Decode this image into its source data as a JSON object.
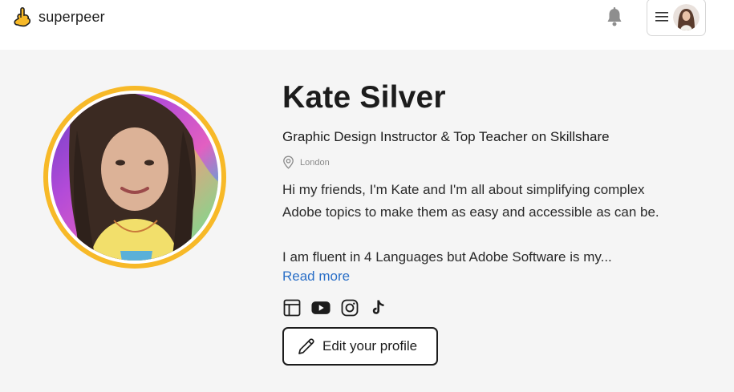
{
  "brand": {
    "name": "superpeer",
    "accent": "#f7b928"
  },
  "header": {
    "icons": {
      "notifications": "bell-icon",
      "menu": "hamburger-icon"
    }
  },
  "profile": {
    "name": "Kate Silver",
    "headline": "Graphic Design Instructor & Top Teacher on Skillshare",
    "location": "London",
    "bio_line1": "Hi my friends, I'm Kate and I'm all about simplifying complex",
    "bio_line2": "Adobe topics to make them as easy and accessible as can be.",
    "bio_line3": "I am fluent in 4 Languages but Adobe Software is my...",
    "read_more": "Read more",
    "avatar_ring_color": "#f7b928",
    "socials": [
      "website-icon",
      "youtube-icon",
      "instagram-icon",
      "tiktok-icon"
    ],
    "edit_button": "Edit your profile"
  },
  "colors": {
    "link": "#2a6fc7",
    "background": "#f5f5f5"
  }
}
